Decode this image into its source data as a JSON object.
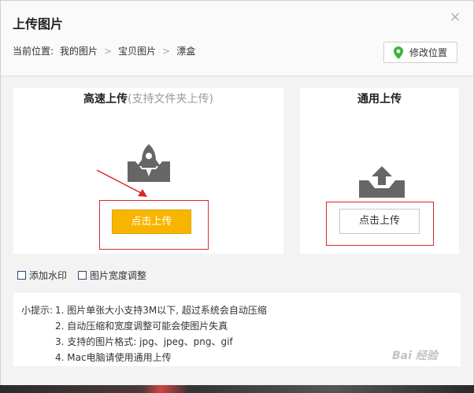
{
  "dialog": {
    "title": "上传图片",
    "close_symbol": "×"
  },
  "breadcrumb": {
    "prefix": "当前位置:",
    "items": [
      "我的图片",
      "宝贝图片",
      "漂盒"
    ],
    "separator": ">"
  },
  "location_button": {
    "label": "修改位置",
    "icon": "location-pin-icon",
    "icon_color": "#3bb33b"
  },
  "fast_upload": {
    "title": "高速上传",
    "subtitle": "(支持文件夹上传)",
    "icon": "rocket-tray-icon",
    "button_label": "点击上传",
    "button_color": "#f8b500"
  },
  "normal_upload": {
    "title": "通用上传",
    "icon": "upload-tray-icon",
    "button_label": "点击上传"
  },
  "options": [
    {
      "label": "添加水印",
      "checked": false
    },
    {
      "label": "图片宽度调整",
      "checked": false
    }
  ],
  "tips": {
    "prefix": "小提示:",
    "lines": [
      "1. 图片单张大小支持3M以下, 超过系统会自动压缩",
      "2. 自动压缩和宽度调整可能会使图片失真",
      "3. 支持的图片格式: jpg、jpeg、png、gif",
      "4. Mac电脑请使用通用上传"
    ]
  },
  "watermark": "Bai 经验",
  "annotation_color": "#d62a2a"
}
